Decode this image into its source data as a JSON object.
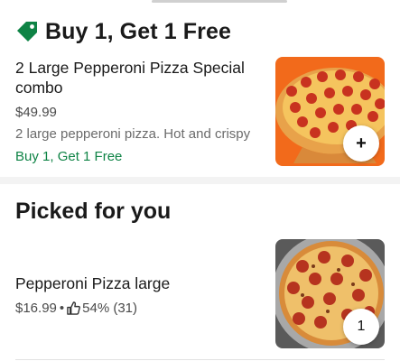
{
  "promo_section": {
    "title": "Buy 1, Get 1 Free",
    "icon": "tag-icon",
    "items": [
      {
        "name": "2 Large Pepperoni Pizza Special combo",
        "price": "$49.99",
        "description": "2 large pepperoni pizza. Hot and crispy",
        "promo": "Buy 1, Get 1 Free",
        "button": "+"
      }
    ]
  },
  "picked_section": {
    "title": "Picked for you",
    "items": [
      {
        "name": "Pepperoni Pizza large",
        "price": "$16.99",
        "separator": "•",
        "rating": "54% (31)",
        "rating_icon": "thumbs-up-icon",
        "quantity": "1"
      }
    ]
  },
  "colors": {
    "promo_green": "#0e8345",
    "image_bg_orange": "#f26a1b",
    "image_bg_gray": "#5a5a5a"
  }
}
